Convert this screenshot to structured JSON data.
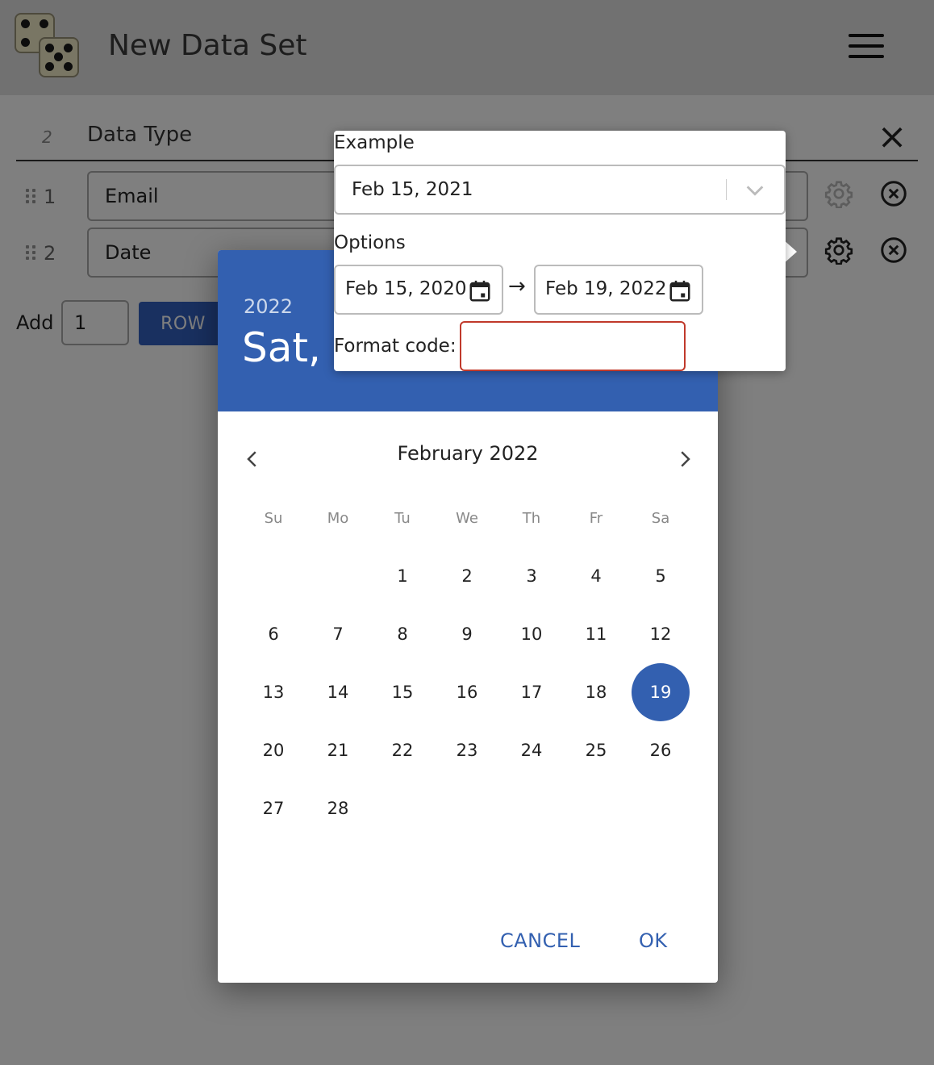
{
  "app": {
    "title": "New Data Set"
  },
  "table": {
    "row_count": "2",
    "column_header": "Data Type",
    "rows": [
      {
        "num": "1",
        "type": "Email"
      },
      {
        "num": "2",
        "type": "Date"
      }
    ]
  },
  "add_rows": {
    "label": "Add",
    "count": "1",
    "button_label": "ROW"
  },
  "popover": {
    "example_label": "Example",
    "example_value": "Feb 15, 2021",
    "options_label": "Options",
    "start_date": "Feb 15, 2020",
    "range_arrow": "→",
    "end_date": "Feb 19, 2022",
    "format_label": "Format code:",
    "format_value": ""
  },
  "date_picker": {
    "year": "2022",
    "header_date": "Sat, F",
    "month_label": "February 2022",
    "weekdays": [
      "Su",
      "Mo",
      "Tu",
      "We",
      "Th",
      "Fr",
      "Sa"
    ],
    "first_weekday_index": 2,
    "days_in_month": 28,
    "selected_day": 19,
    "cancel_label": "CANCEL",
    "ok_label": "OK",
    "accent_color": "#3360b0"
  }
}
